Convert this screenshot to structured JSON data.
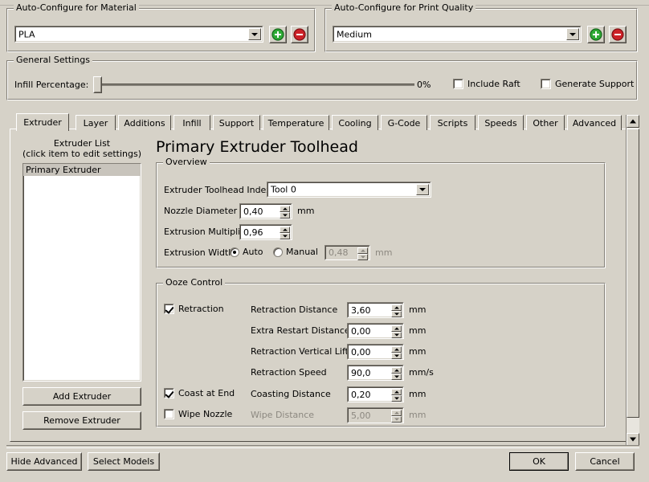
{
  "window": {
    "accent_green": "#2eaa35",
    "accent_red": "#cc2127",
    "face": "#d6d2c8"
  },
  "material_group": {
    "title": "Auto-Configure for Material",
    "combo_value": "PLA",
    "add_label": "+",
    "remove_label": "−"
  },
  "quality_group": {
    "title": "Auto-Configure for Print Quality",
    "combo_value": "Medium",
    "add_label": "+",
    "remove_label": "−"
  },
  "general_group": {
    "title": "General Settings",
    "infill_label": "Infill Percentage:",
    "infill_value": "0%",
    "include_raft_label": "Include Raft",
    "include_raft_checked": false,
    "generate_support_label": "Generate Support",
    "generate_support_checked": false
  },
  "tabs": {
    "items": [
      {
        "label": "Extruder",
        "active": true
      },
      {
        "label": "Layer",
        "active": false
      },
      {
        "label": "Additions",
        "active": false
      },
      {
        "label": "Infill",
        "active": false
      },
      {
        "label": "Support",
        "active": false
      },
      {
        "label": "Temperature",
        "active": false
      },
      {
        "label": "Cooling",
        "active": false
      },
      {
        "label": "G-Code",
        "active": false
      },
      {
        "label": "Scripts",
        "active": false
      },
      {
        "label": "Speeds",
        "active": false
      },
      {
        "label": "Other",
        "active": false
      },
      {
        "label": "Advanced",
        "active": false
      }
    ]
  },
  "extruder_list": {
    "title": "Extruder List",
    "subtitle": "(click item to edit settings)",
    "items": [
      "Primary Extruder"
    ],
    "selected_index": 0,
    "add_button": "Add Extruder",
    "remove_button": "Remove Extruder"
  },
  "page": {
    "title": "Primary Extruder Toolhead"
  },
  "overview": {
    "title": "Overview",
    "toolhead_index_label": "Extruder Toolhead Index",
    "toolhead_index_value": "Tool 0",
    "nozzle_diameter_label": "Nozzle Diameter",
    "nozzle_diameter_value": "0,40",
    "nozzle_diameter_unit": "mm",
    "extrusion_multiplier_label": "Extrusion Multiplier",
    "extrusion_multiplier_value": "0,96",
    "extrusion_width_label": "Extrusion Width",
    "extrusion_width_auto_label": "Auto",
    "extrusion_width_manual_label": "Manual",
    "extrusion_width_mode": "auto",
    "extrusion_width_value": "0,48",
    "extrusion_width_unit": "mm"
  },
  "ooze_control": {
    "title": "Ooze Control",
    "retraction_label": "Retraction",
    "retraction_checked": true,
    "coast_label": "Coast at End",
    "coast_checked": true,
    "wipe_label": "Wipe Nozzle",
    "wipe_checked": false,
    "rows": [
      {
        "label": "Retraction Distance",
        "value": "3,60",
        "unit": "mm",
        "disabled": false
      },
      {
        "label": "Extra Restart Distance",
        "value": "0,00",
        "unit": "mm",
        "disabled": false
      },
      {
        "label": "Retraction Vertical Lift",
        "value": "0,00",
        "unit": "mm",
        "disabled": false
      },
      {
        "label": "Retraction Speed",
        "value": "90,0",
        "unit": "mm/s",
        "disabled": false
      },
      {
        "label": "Coasting Distance",
        "value": "0,20",
        "unit": "mm",
        "disabled": false
      },
      {
        "label": "Wipe Distance",
        "value": "5,00",
        "unit": "mm",
        "disabled": true
      }
    ]
  },
  "footer": {
    "hide_advanced": "Hide Advanced",
    "select_models": "Select Models",
    "ok": "OK",
    "cancel": "Cancel"
  }
}
